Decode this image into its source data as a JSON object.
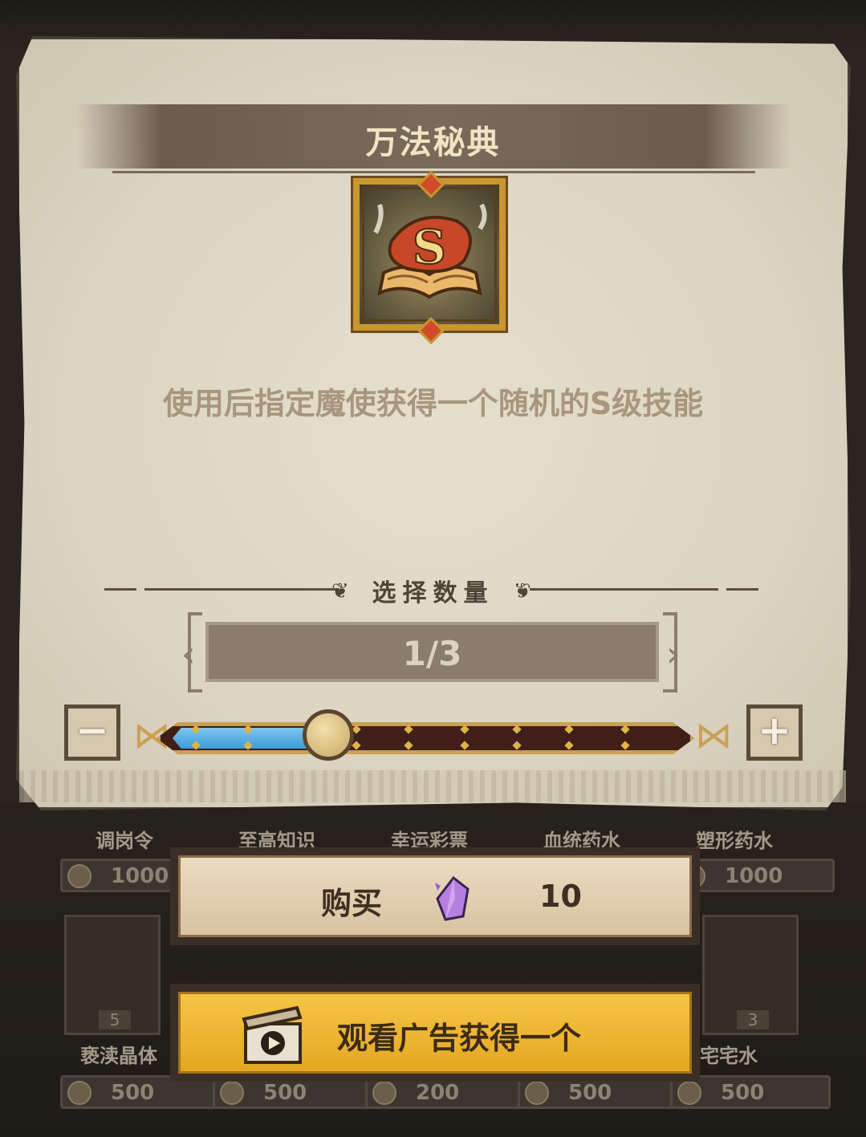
{
  "dialog": {
    "title": "万法秘典",
    "description": "使用后指定魔使获得一个随机的S级技能",
    "item_icon": "spellbook-s-icon"
  },
  "quantity": {
    "label": "选择数量",
    "display": "1/3",
    "selected": 1,
    "max": 3,
    "slider_fraction": 0.333,
    "minus_icon": "minus-icon",
    "plus_icon": "plus-icon"
  },
  "buy": {
    "label": "购买",
    "currency_icon": "purple-crystal-icon",
    "price": "10"
  },
  "watch_ad": {
    "label": "观看广告获得一个",
    "icon": "video-clapper-icon"
  },
  "background_shop": {
    "names_row1": [
      "调岗令",
      "至高知识",
      "幸运彩票",
      "血统药水",
      "塑形药水"
    ],
    "prices_row1": [
      "1000",
      "1000"
    ],
    "counts_row2": [
      "5",
      "3"
    ],
    "names_row2": [
      "亵渎晶体",
      "宅宅水"
    ],
    "prices_row2": [
      "500",
      "500",
      "200",
      "500",
      "500"
    ]
  },
  "colors": {
    "parchment": "#ddd5c2",
    "title_band": "#6c5c4e",
    "slider_fill": "#3c9ad7",
    "gold": "#c9962f",
    "ad_button": "#f5c545"
  }
}
